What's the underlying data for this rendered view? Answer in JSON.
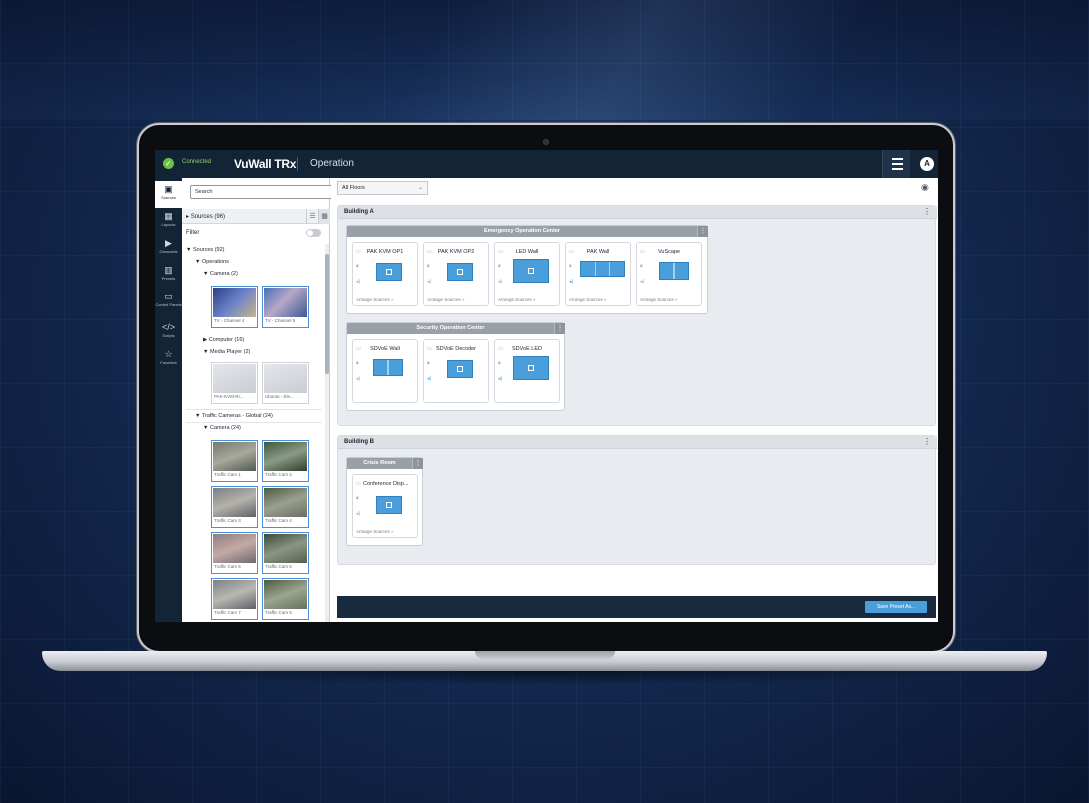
{
  "window": {
    "title": "VuWall TRx",
    "mode": "Operation",
    "status": "Connected",
    "user_initial": "A"
  },
  "rail": {
    "items": [
      {
        "label": "Sources",
        "icon": "sources-icon"
      },
      {
        "label": "Layouts",
        "icon": "layouts-icon"
      },
      {
        "label": "Carousels",
        "icon": "carousels-icon"
      },
      {
        "label": "Presets",
        "icon": "presets-icon"
      },
      {
        "label": "Control Panels",
        "icon": "control-panels-icon"
      },
      {
        "label": "Scripts",
        "icon": "scripts-icon"
      },
      {
        "label": "Favorites",
        "icon": "favorites-icon"
      }
    ]
  },
  "sources_panel": {
    "search_placeholder": "Search",
    "header": "Sources (96)",
    "filter_label": "Filter",
    "tree": {
      "root": "Sources (92)",
      "operations": "Operations",
      "camera": "Camera (2)",
      "computer": "Computer (16)",
      "media_player": "Media Player (2)",
      "traffic": "Traffic Cameras - Global (24)",
      "traffic_camera": "Camera (24)"
    },
    "thumbs_operations": [
      "TV - Channel 4",
      "TV - Channel 5"
    ],
    "thumbs_media": [
      "PAK-KVM-Ri...",
      "Ubuntu - Ele..."
    ],
    "thumbs_traffic": [
      "Traffic Cam 1",
      "Traffic Cam 2",
      "Traffic Cam 3",
      "Traffic Cam 4",
      "Traffic Cam 5",
      "Traffic Cam 6",
      "Traffic Cam 7",
      "Traffic Cam 8"
    ]
  },
  "main": {
    "floor_select": "All Floors",
    "buildings": [
      {
        "name": "Building A",
        "groups": [
          {
            "name": "Emergency Operation Center",
            "displays": [
              "PAK KVM OP1",
              "PAK KVM OP2",
              "LED Wall",
              "PAK Wall",
              "VuScape"
            ]
          },
          {
            "name": "Security Operation Center",
            "displays": [
              "SDVoE Wall",
              "SDVoE Decoder",
              "SDVoE LED"
            ]
          }
        ]
      },
      {
        "name": "Building B",
        "groups": [
          {
            "name": "Crisis Room",
            "displays": [
              "Conference Disp..."
            ]
          }
        ]
      }
    ],
    "arrange_label": "Arrange Sources »",
    "save_button": "Save Preset As..."
  },
  "colors": {
    "topbar": "#142437",
    "accent": "#4a9fdb",
    "connected": "#6cc04a"
  }
}
